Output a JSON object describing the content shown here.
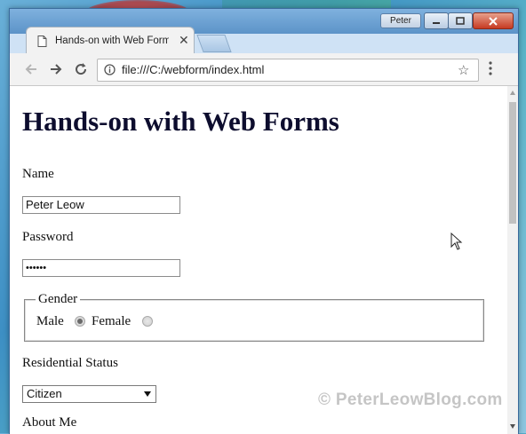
{
  "window": {
    "user_badge": "Peter",
    "tab_title": "Hands-on with Web Forms"
  },
  "toolbar": {
    "url": "file:///C:/webform/index.html"
  },
  "page": {
    "heading": "Hands-on with Web Forms",
    "name_label": "Name",
    "name_value": "Peter Leow",
    "password_label": "Password",
    "password_value": "••••••",
    "gender_legend": "Gender",
    "male_label": "Male",
    "female_label": "Female",
    "gender_selected": "Male",
    "residential_label": "Residential Status",
    "residential_value": "Citizen",
    "about_label": "About Me"
  },
  "watermark": "© PeterLeowBlog.com",
  "icons": [
    "doc-icon",
    "close-icon",
    "back-icon",
    "forward-icon",
    "reload-icon",
    "info-icon",
    "star-icon",
    "menu-icon",
    "minimize-icon",
    "maximize-icon",
    "close-window-icon",
    "cursor-icon"
  ]
}
